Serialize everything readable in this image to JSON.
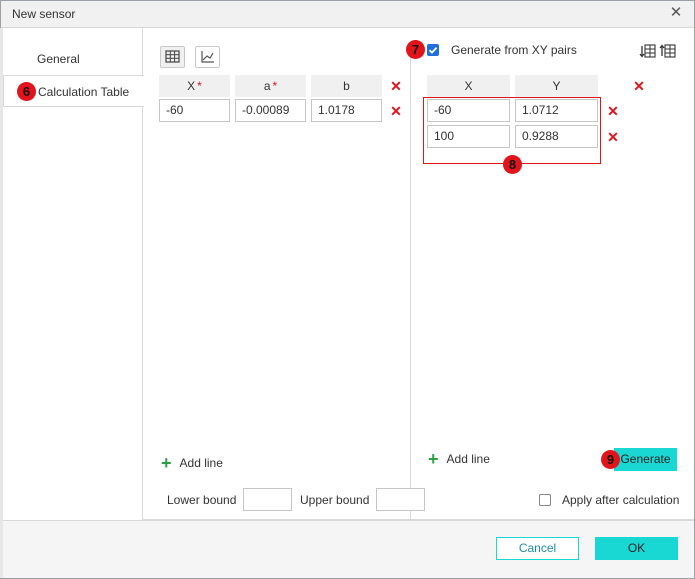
{
  "dialog": {
    "title": "New sensor"
  },
  "sidebar": {
    "items": [
      {
        "label": "General"
      },
      {
        "label": "Calculation Table"
      }
    ]
  },
  "badges": {
    "tab": "6",
    "generate_xy": "7",
    "pairs": "8",
    "generate": "9"
  },
  "left_table": {
    "headers": [
      {
        "label": "X",
        "required": "*"
      },
      {
        "label": "a",
        "required": "*"
      },
      {
        "label": "b",
        "required": ""
      }
    ],
    "rows": [
      {
        "x": "-60",
        "a": "-0.00089",
        "b": "1.0178"
      }
    ],
    "add_line_label": "Add line"
  },
  "right_panel": {
    "generate_checkbox_label": "Generate from XY pairs",
    "generate_checked": true,
    "headers": [
      "X",
      "Y"
    ],
    "rows": [
      {
        "x": "-60",
        "y": "1.0712"
      },
      {
        "x": "100",
        "y": "0.9288"
      }
    ],
    "add_line_label": "Add line",
    "generate_button": "Generate"
  },
  "bounds": {
    "lower_label": "Lower bound",
    "lower_value": "",
    "upper_label": "Upper bound",
    "upper_value": ""
  },
  "apply_after": {
    "label": "Apply after calculation",
    "checked": false
  },
  "footer": {
    "cancel": "Cancel",
    "ok": "OK"
  },
  "colors": {
    "accent": "#19d8d4",
    "danger": "#e2141b",
    "checkbox": "#1e6fd9"
  },
  "icons": {
    "view_table": "table-icon",
    "view_chart": "chart-icon",
    "insert_row_above": "insert-row-above-icon",
    "insert_row_below": "insert-row-below-icon",
    "delete": "delete-x-icon",
    "add": "plus-icon",
    "close": "close-icon"
  }
}
